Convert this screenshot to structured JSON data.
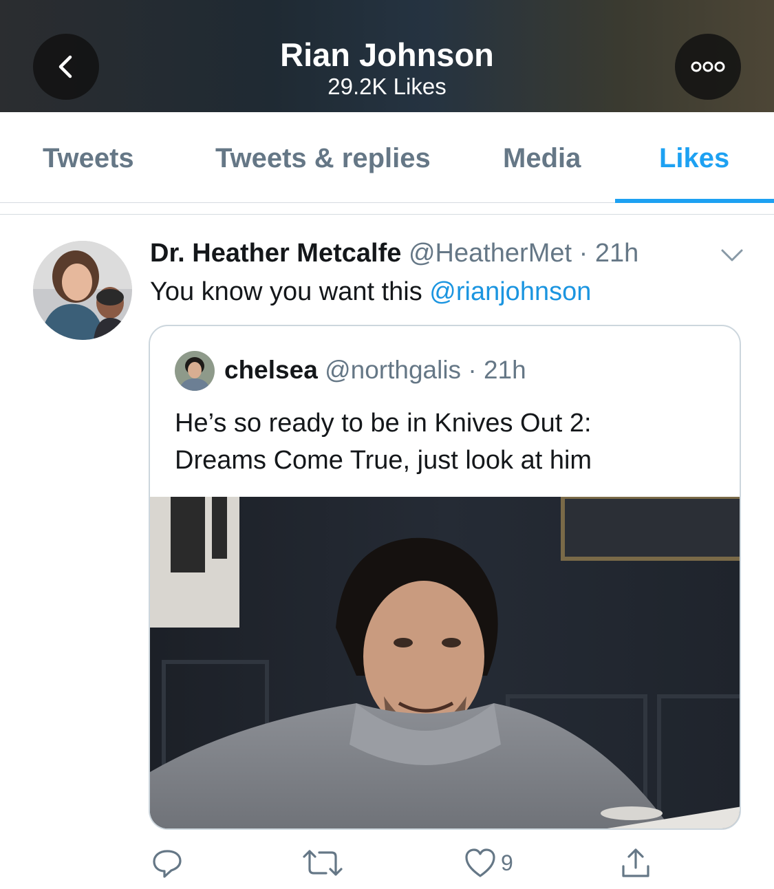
{
  "header": {
    "title": "Rian Johnson",
    "subtitle": "29.2K Likes",
    "back_icon": "chevron-left-icon",
    "more_icon": "more-horizontal-icon"
  },
  "tabs": [
    {
      "label": "Tweets",
      "active": false
    },
    {
      "label": "Tweets & replies",
      "active": false
    },
    {
      "label": "Media",
      "active": false
    },
    {
      "label": "Likes",
      "active": true
    }
  ],
  "tweet": {
    "author_name": "Dr. Heather Metcalfe",
    "author_handle": "@HeatherMet",
    "separator": "·",
    "time": "21h",
    "text": "You know you want this ",
    "mention": "@rianjohnson",
    "quote": {
      "author_name": "chelsea",
      "author_handle": "@northgalis",
      "separator": "·",
      "time": "21h",
      "text_lines": [
        "He’s so ready to be in Knives Out 2:",
        "Dreams Come True, just look at him"
      ]
    },
    "actions": {
      "reply_icon": "reply-icon",
      "retweet_icon": "retweet-icon",
      "like_icon": "heart-icon",
      "like_count": "9",
      "share_icon": "share-icon"
    }
  },
  "colors": {
    "accent": "#1da1f2",
    "mention": "#1b95e0",
    "muted": "#657786",
    "text": "#14171a"
  }
}
